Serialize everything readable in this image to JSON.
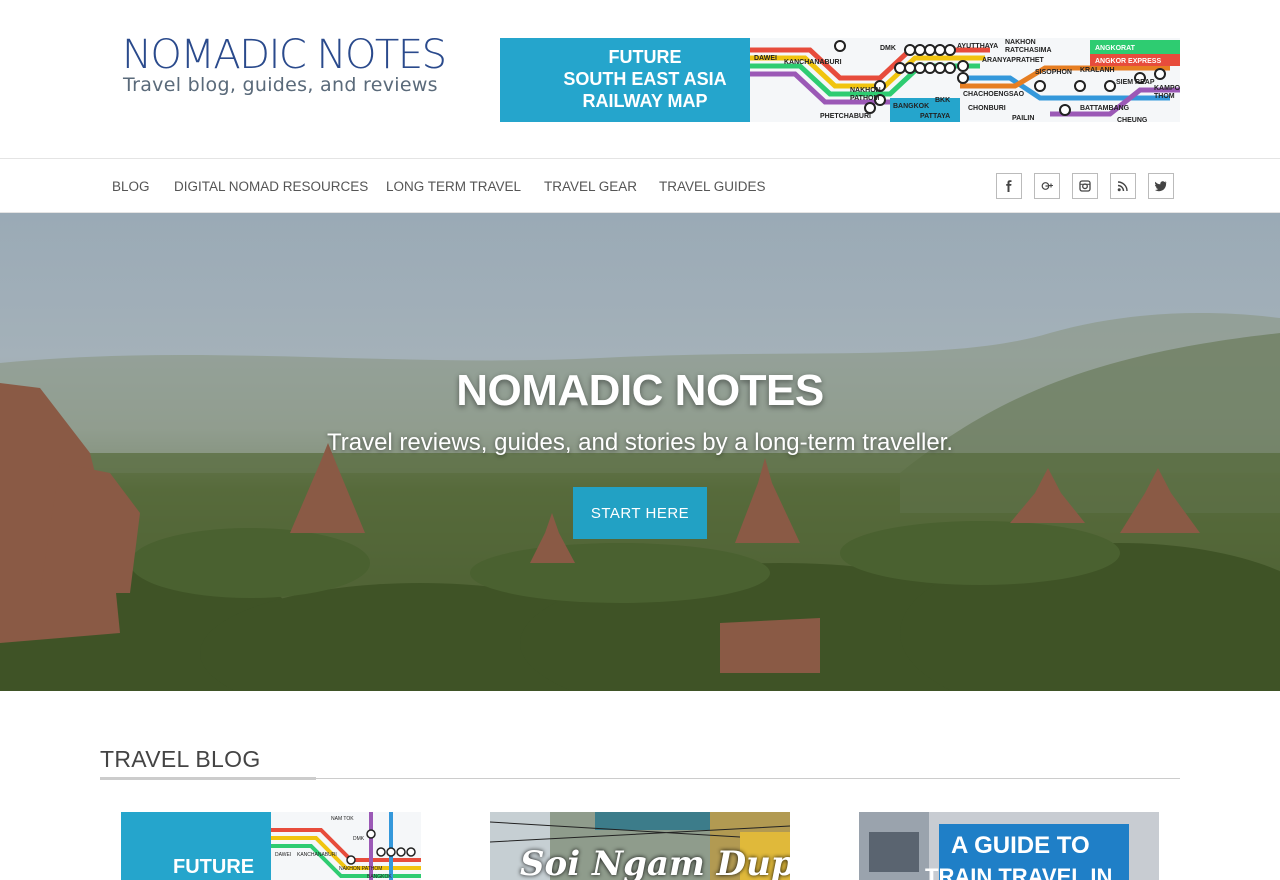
{
  "header": {
    "logo_title": "NOMADIC NOTES",
    "logo_tagline": "Travel blog, guides, and reviews",
    "banner": {
      "lines": [
        "FUTURE",
        "SOUTH EAST ASIA",
        "RAILWAY MAP"
      ],
      "map_labels": [
        "DAWEI",
        "KANCHANABURI",
        "NAKHON PATHOM",
        "PHETCHABURI",
        "DMK",
        "AYUTTHAYA",
        "BANGKOK",
        "BKK",
        "PATTAYA",
        "CHACHOENGSAO",
        "CHONBURI",
        "ARANYAPRATHET",
        "NAKHON RATCHASIMA",
        "ANGKORAT",
        "ANGKOR EXPRESS",
        "SISOPHON",
        "KRALANH",
        "SIEM REAP",
        "KAMPONG THOM",
        "BATTAMBANG",
        "PAILIN",
        "CHEUNG"
      ]
    }
  },
  "nav": {
    "items": [
      "BLOG",
      "DIGITAL NOMAD RESOURCES",
      "LONG TERM TRAVEL",
      "TRAVEL GEAR",
      "TRAVEL GUIDES"
    ],
    "social": [
      "facebook-icon",
      "google-plus-icon",
      "instagram-icon",
      "rss-icon",
      "twitter-icon"
    ]
  },
  "hero": {
    "title": "NOMADIC NOTES",
    "subtitle": "Travel reviews, guides, and stories by a long-term traveller.",
    "cta": "START HERE"
  },
  "blog": {
    "section_title": "TRAVEL BLOG",
    "cards": [
      {
        "text": "FUTURE",
        "sub_labels": [
          "NAM TOK",
          "DAWEI",
          "KANCHANABURI",
          "NAKHON PATHOM",
          "BANGKOK",
          "DMK"
        ]
      },
      {
        "text": "Soi Ngam Dupli"
      },
      {
        "text": "A GUIDE TO",
        "text2": "TRAIN TRAVEL IN"
      }
    ]
  },
  "colors": {
    "accent": "#22a1c4",
    "logo": "#2a4a8c",
    "banner": "#25a5cc"
  }
}
